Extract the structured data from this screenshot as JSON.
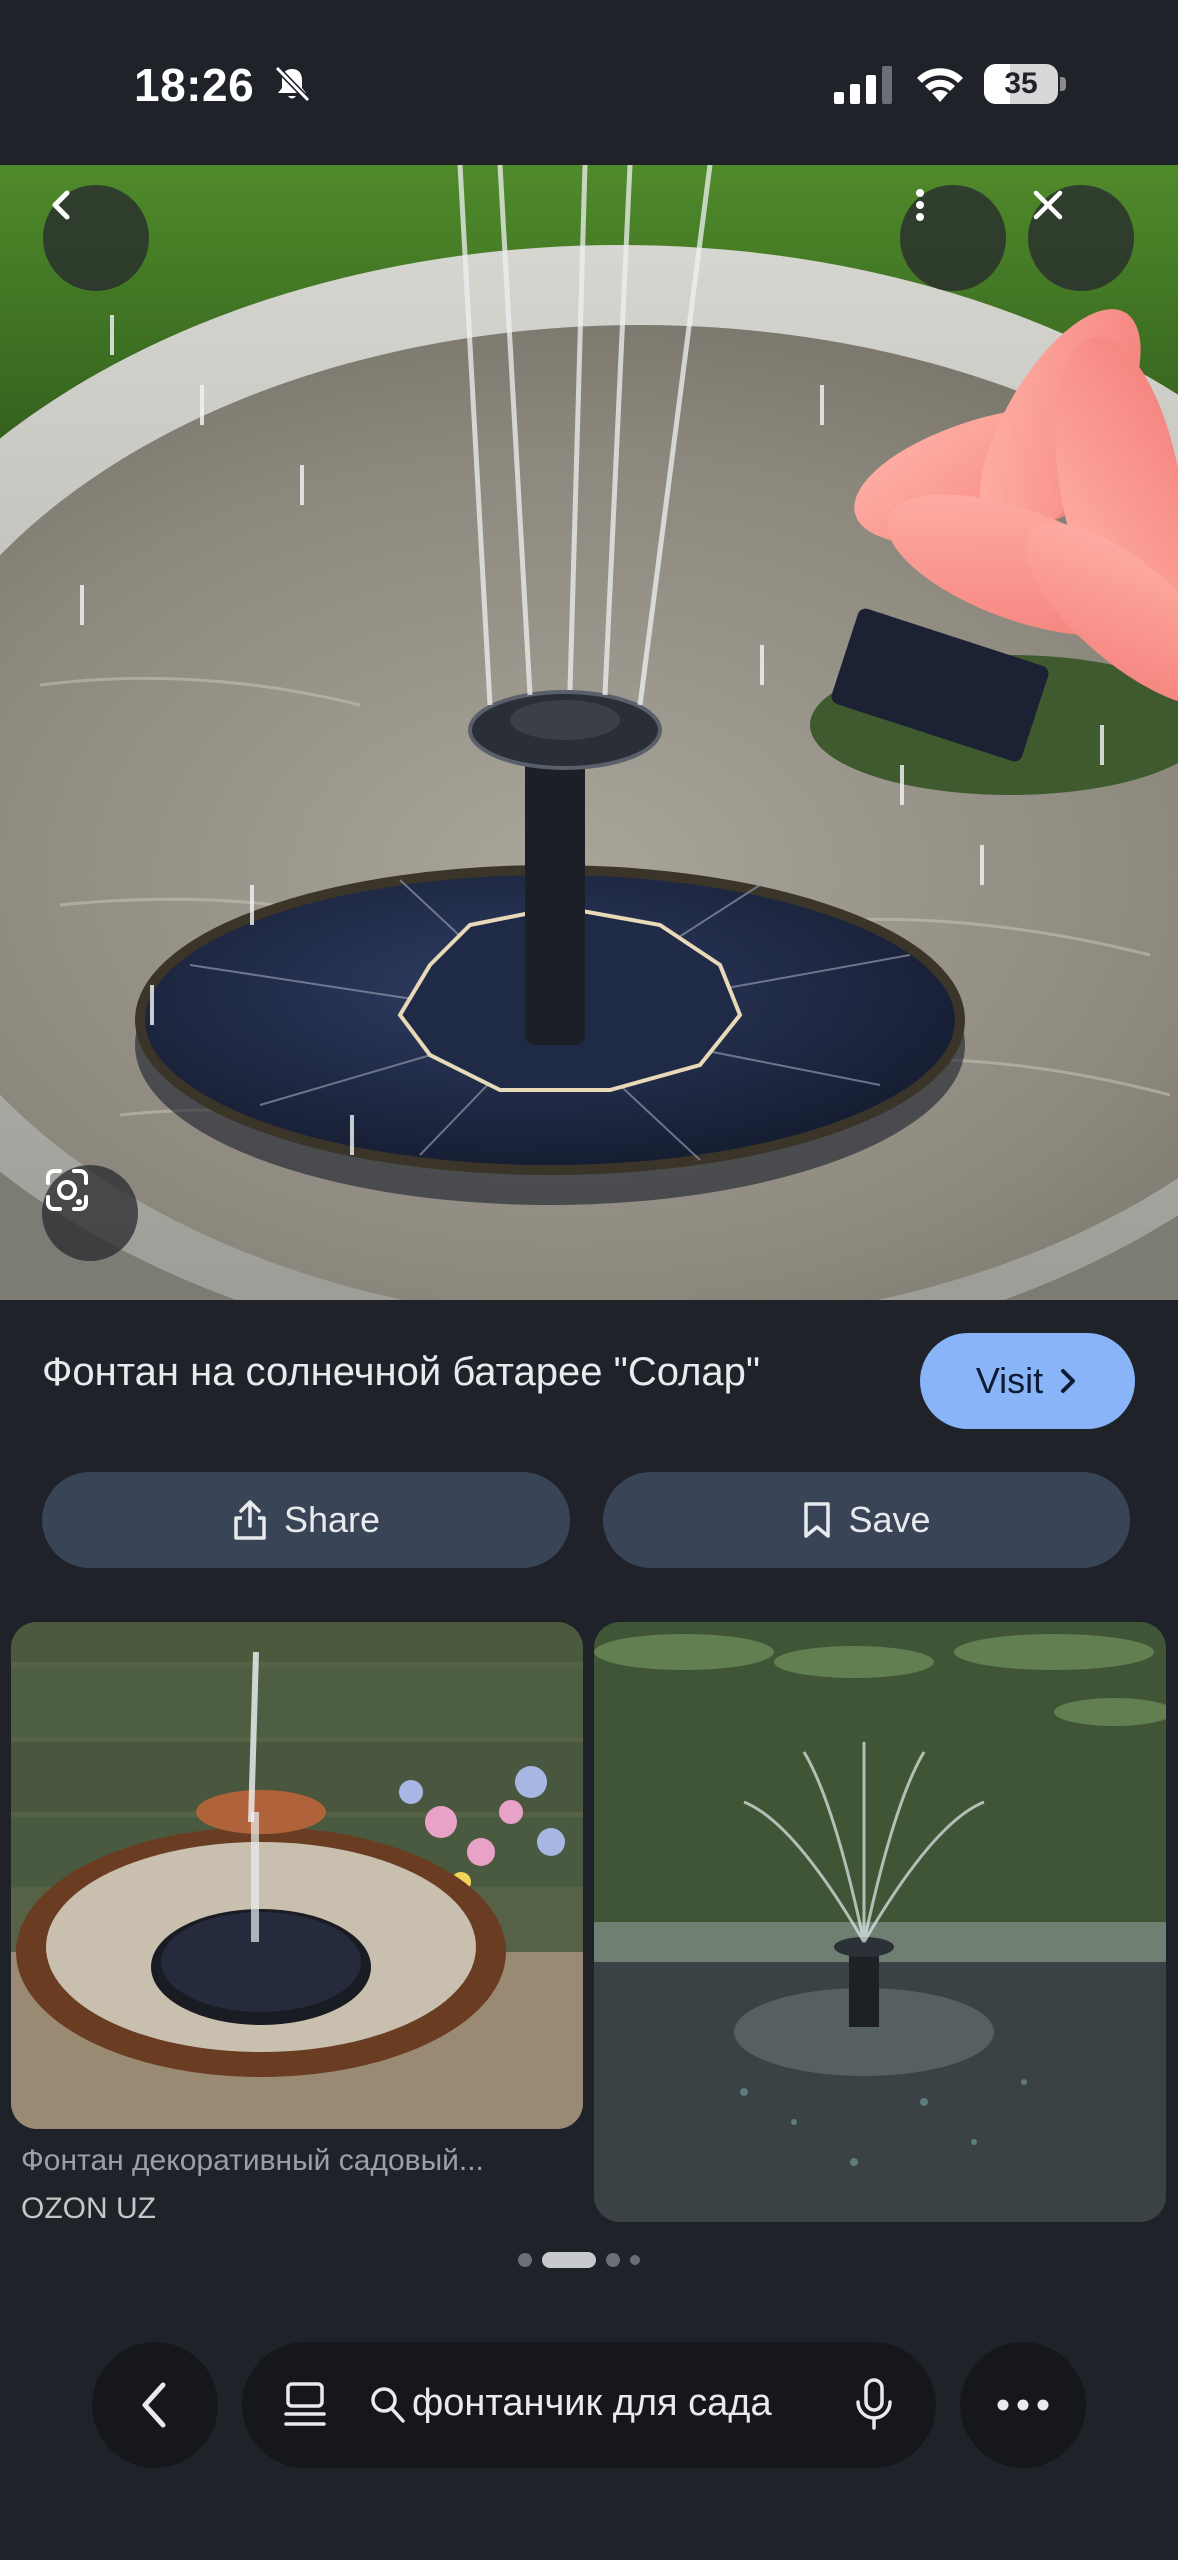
{
  "status_bar": {
    "time": "18:26",
    "battery": "35",
    "battery_level": 0.35
  },
  "hero": {
    "icons": [
      "back-arrow-icon",
      "more-vert-icon",
      "close-icon",
      "google-lens-icon"
    ]
  },
  "result": {
    "title": "Фонтан на солнечной батарее \"Солар\"",
    "visit_label": "Visit"
  },
  "actions": {
    "share_label": "Share",
    "save_label": "Save"
  },
  "related": {
    "items": [
      {
        "caption": "Фонтан декоративный садовый...",
        "source": "OZON UZ"
      }
    ]
  },
  "pager": {
    "count": 4,
    "active_index": 1
  },
  "bottom_bar": {
    "query": "фонтанчик для сада",
    "icons": [
      "back-icon",
      "tabs-icon",
      "search-icon",
      "mic-icon",
      "more-horiz-icon"
    ]
  },
  "colors": {
    "background": "#1f2229",
    "accent": "#8ab4f8",
    "action_button": "#394457"
  }
}
